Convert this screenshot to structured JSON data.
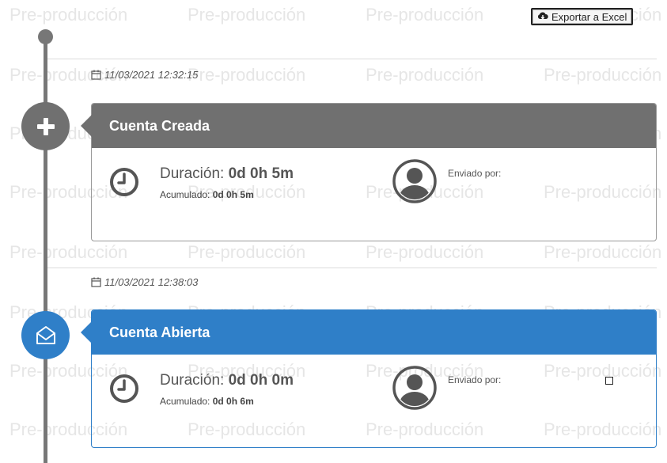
{
  "watermark": {
    "text": "Pre-producción"
  },
  "toolbar": {
    "export_label": "Exportar a Excel",
    "export_icon": "cloud-download-icon"
  },
  "events": [
    {
      "date": "11/03/2021 12:32:15",
      "title": "Cuenta Creada",
      "icon": "plus-icon",
      "color": "#707070",
      "duration_label": "Duración:",
      "duration_value": "0d 0h 5m",
      "accum_label": "Acumulado:",
      "accum_value": "0d 0h 5m",
      "sent_by_label": "Enviado por:"
    },
    {
      "date": "11/03/2021 12:38:03",
      "title": "Cuenta Abierta",
      "icon": "open-envelope-icon",
      "color": "#2f7fc8",
      "duration_label": "Duración:",
      "duration_value": "0d 0h 0m",
      "accum_label": "Acumulado:",
      "accum_value": "0d 0h 6m",
      "sent_by_label": "Enviado por:"
    }
  ]
}
